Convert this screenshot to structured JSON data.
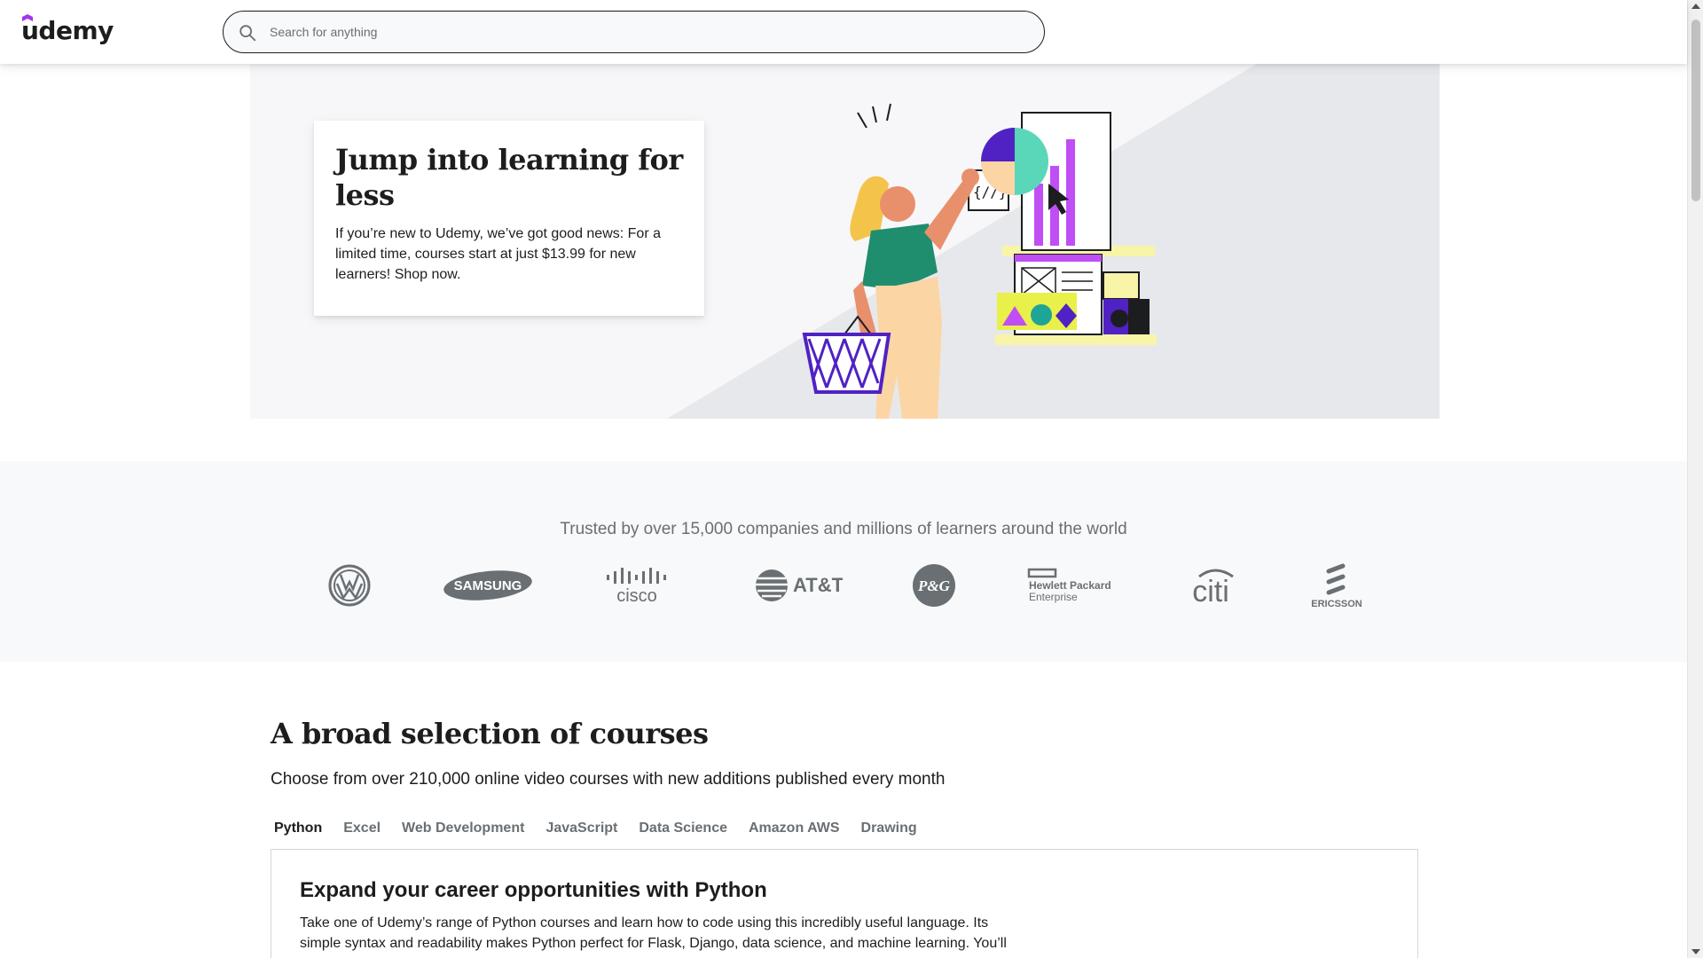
{
  "header": {
    "logo_text": "udemy",
    "brand_color": "#a435f0",
    "search": {
      "placeholder": "Search for anything",
      "value": "",
      "icon": "search-icon"
    }
  },
  "hero": {
    "title": "Jump into learning for less",
    "text": "If you’re new to Udemy, we’ve got good news: For a limited time, courses start at just $13.99 for new learners! Shop now."
  },
  "trusted": {
    "text": "Trusted by over 15,000 companies and millions of learners around the world",
    "logos": [
      {
        "name": "Volkswagen",
        "label": ""
      },
      {
        "name": "Samsung",
        "label": "SAMSUNG"
      },
      {
        "name": "Cisco",
        "label": "cisco"
      },
      {
        "name": "AT&T",
        "label": "AT&T"
      },
      {
        "name": "P&G",
        "label": "P&G"
      },
      {
        "name": "Hewlett Packard Enterprise",
        "label": "Hewlett Packard",
        "label2": "Enterprise"
      },
      {
        "name": "Citi",
        "label": "citi"
      },
      {
        "name": "Ericsson",
        "label": "ERICSSON"
      }
    ]
  },
  "courses": {
    "title": "A broad selection of courses",
    "subtitle": "Choose from over 210,000 online video courses with new additions published every month",
    "tabs": [
      {
        "label": "Python",
        "active": true
      },
      {
        "label": "Excel",
        "active": false
      },
      {
        "label": "Web Development",
        "active": false
      },
      {
        "label": "JavaScript",
        "active": false
      },
      {
        "label": "Data Science",
        "active": false
      },
      {
        "label": "Amazon AWS",
        "active": false
      },
      {
        "label": "Drawing",
        "active": false
      }
    ],
    "panel": {
      "title": "Expand your career opportunities with Python",
      "text": "Take one of Udemy’s range of Python courses and learn how to code using this incredibly useful language. Its simple syntax and readability makes Python perfect for Flask, Django, data science, and machine learning. You’ll"
    }
  }
}
